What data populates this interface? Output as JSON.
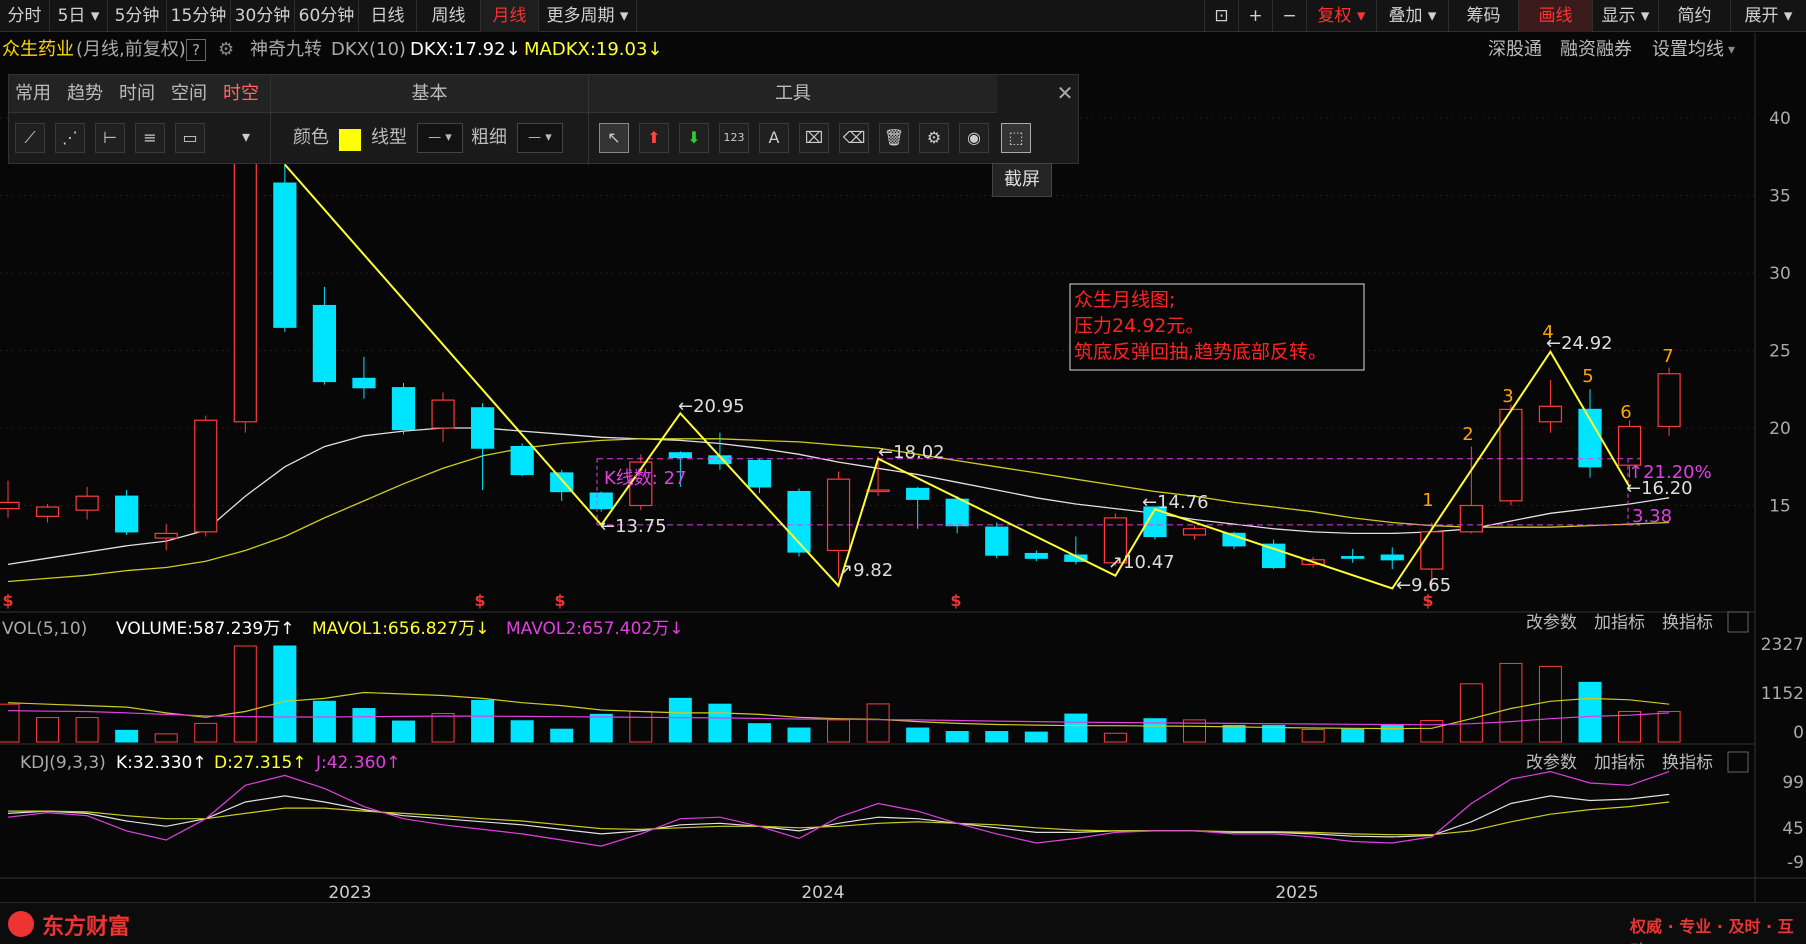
{
  "periods": [
    "分时",
    "5日",
    "5分钟",
    "15分钟",
    "30分钟",
    "60分钟",
    "日线",
    "周线",
    "月线",
    "更多周期"
  ],
  "active_period": "月线",
  "right_buttons": [
    "复权",
    "叠加",
    "筹码",
    "画线",
    "显示",
    "简约",
    "展开"
  ],
  "stock": {
    "name": "众生药业",
    "mode": "(月线,前复权)",
    "help": "?",
    "indicator": "神奇九转",
    "dkx_label": "DKX(10)",
    "dkx": "DKX:17.92↓",
    "madkx": "MADKX:19.03↓"
  },
  "top_links": [
    "深股通",
    "融资融券",
    "设置均线"
  ],
  "draw_panel": {
    "tabs": [
      "常用",
      "趋势",
      "时间",
      "空间",
      "时空"
    ],
    "active_tab": "时空",
    "basic_title": "基本",
    "tools_title": "工具",
    "color_label": "颜色",
    "line_label": "线型",
    "width_label": "粗细",
    "tooltip": "截屏"
  },
  "annotation": [
    "众生月线图;",
    "压力24.92元。",
    "筑底反弹回抽,趋势底部反转。"
  ],
  "price_axis": [
    "40",
    "35",
    "30",
    "25",
    "20",
    "15"
  ],
  "point_labels": {
    "p1": "←20.95",
    "p2": "←18.02",
    "p3": "←14.76",
    "p4": "←13.75",
    "p5": "↗9.82",
    "p6": "↗10.47",
    "p7": "←9.65",
    "p8": "←24.92",
    "p9": "←16.20",
    "k_count": "K线数: 27",
    "pct": "↑21.20%",
    "diff": "3.38"
  },
  "wave_labels": [
    "1",
    "2",
    "3",
    "4",
    "5",
    "6",
    "7"
  ],
  "vol": {
    "label": "VOL(5,10)",
    "volume": "VOLUME:587.239万↑",
    "mavol1": "MAVOL1:656.827万↓",
    "mavol2": "MAVOL2:657.402万↓",
    "axis": [
      "2327",
      "1152",
      "0"
    ]
  },
  "kdj": {
    "label": "KDJ(9,3,3)",
    "k": "K:32.330↑",
    "d": "D:27.315↑",
    "j": "J:42.360↑",
    "axis": [
      "99",
      "45",
      "-9"
    ]
  },
  "panel_links": [
    "改参数",
    "加指标",
    "换指标"
  ],
  "years": [
    "2023",
    "2024",
    "2025"
  ],
  "brand": "东方财富",
  "slogan": "权威 · 专业 · 及时 · 互动",
  "colors": {
    "up": "#ff3b3b",
    "down": "#00e5ff",
    "yellow": "#ffff33",
    "magenta": "#e040e0",
    "white": "#e0e0e0",
    "orange": "#ffa500"
  },
  "chart_data": {
    "type": "candlestick",
    "candles": [
      [
        14.8,
        15.2,
        16.6,
        14.2
      ],
      [
        14.3,
        14.9,
        15.1,
        13.9
      ],
      [
        14.7,
        15.6,
        16.2,
        14.1
      ],
      [
        15.6,
        13.3,
        16.0,
        13.1
      ],
      [
        12.9,
        13.2,
        13.8,
        12.1
      ],
      [
        13.3,
        20.5,
        20.8,
        13.0
      ],
      [
        20.4,
        39.0,
        39.5,
        19.7
      ],
      [
        35.8,
        26.5,
        38.0,
        26.2
      ],
      [
        27.9,
        23.0,
        29.1,
        22.8
      ],
      [
        23.2,
        22.6,
        24.6,
        21.9
      ],
      [
        22.6,
        19.9,
        22.9,
        19.6
      ],
      [
        20.0,
        21.8,
        22.3,
        19.1
      ],
      [
        21.3,
        18.7,
        21.6,
        16.0
      ],
      [
        18.8,
        17.0,
        19.0,
        16.9
      ],
      [
        17.1,
        15.9,
        17.3,
        15.3
      ],
      [
        15.8,
        14.8,
        15.9,
        14.6
      ],
      [
        15.0,
        17.8,
        18.3,
        14.7
      ],
      [
        18.4,
        18.1,
        18.5,
        16.2
      ],
      [
        18.2,
        17.7,
        19.7,
        17.3
      ],
      [
        17.9,
        16.2,
        18.0,
        15.8
      ],
      [
        15.9,
        12.0,
        16.1,
        11.7
      ],
      [
        12.1,
        16.7,
        17.2,
        10.3
      ],
      [
        16.0,
        16.0,
        18.2,
        15.6
      ],
      [
        16.1,
        15.4,
        16.2,
        13.5
      ],
      [
        15.4,
        13.7,
        15.6,
        13.2
      ],
      [
        13.6,
        11.8,
        13.9,
        11.6
      ],
      [
        11.9,
        11.6,
        12.1,
        11.4
      ],
      [
        11.8,
        11.4,
        13.0,
        11.2
      ],
      [
        11.3,
        14.2,
        14.5,
        11.1
      ],
      [
        14.9,
        13.0,
        14.9,
        12.8
      ],
      [
        13.1,
        13.5,
        13.7,
        12.8
      ],
      [
        13.2,
        12.4,
        13.3,
        12.2
      ],
      [
        12.5,
        11.0,
        12.8,
        10.9
      ],
      [
        11.2,
        11.5,
        11.7,
        11.0
      ],
      [
        11.7,
        11.6,
        12.2,
        11.3
      ],
      [
        11.8,
        11.5,
        12.3,
        10.9
      ],
      [
        10.9,
        13.3,
        13.9,
        9.7
      ],
      [
        13.3,
        15.0,
        18.8,
        13.2
      ],
      [
        15.3,
        21.2,
        21.5,
        15.0
      ],
      [
        20.4,
        21.4,
        23.1,
        19.7
      ],
      [
        21.2,
        17.5,
        22.5,
        16.8
      ],
      [
        17.6,
        20.1,
        20.5,
        16.8
      ],
      [
        20.1,
        23.5,
        23.9,
        19.5
      ]
    ],
    "zigzag": [
      [
        7,
        37.0
      ],
      [
        15,
        13.75
      ],
      [
        17,
        20.95
      ],
      [
        21,
        9.82
      ],
      [
        22,
        18.02
      ],
      [
        28,
        10.47
      ],
      [
        29,
        14.76
      ],
      [
        35,
        9.65
      ],
      [
        39,
        24.92
      ],
      [
        41,
        16.2
      ]
    ],
    "ma_white": [
      11.2,
      11.6,
      12.0,
      12.4,
      12.7,
      13.4,
      15.6,
      17.5,
      18.8,
      19.5,
      19.8,
      20.0,
      20.0,
      19.8,
      19.6,
      19.4,
      19.3,
      19.2,
      19.0,
      18.7,
      18.3,
      17.8,
      17.4,
      17.0,
      16.5,
      16.0,
      15.5,
      15.1,
      14.8,
      14.5,
      14.1,
      13.8,
      13.5,
      13.3,
      13.2,
      13.2,
      13.3,
      13.5,
      14.0,
      14.5,
      14.8,
      15.1,
      15.5
    ],
    "ma_yellow": [
      10.1,
      10.3,
      10.5,
      10.8,
      11.0,
      11.4,
      12.1,
      13.0,
      14.2,
      15.3,
      16.4,
      17.4,
      18.2,
      18.7,
      19.0,
      19.2,
      19.3,
      19.3,
      19.3,
      19.2,
      19.1,
      18.9,
      18.7,
      18.3,
      17.9,
      17.5,
      17.1,
      16.7,
      16.3,
      15.9,
      15.6,
      15.2,
      14.9,
      14.6,
      14.2,
      13.9,
      13.7,
      13.6,
      13.6,
      13.6,
      13.7,
      13.8,
      13.9
    ],
    "volume": [
      1300,
      840,
      840,
      400,
      280,
      640,
      3300,
      3300,
      1400,
      1150,
      720,
      980,
      1430,
      730,
      440,
      950,
      1050,
      1500,
      1300,
      630,
      480,
      760,
      1310,
      480,
      360,
      360,
      340,
      960,
      300,
      800,
      760,
      570,
      570,
      430,
      450,
      580,
      740,
      2000,
      2700,
      2600,
      2050,
      1050,
      1050
    ],
    "mavol1": [
      1350,
      1300,
      1250,
      1200,
      1000,
      850,
      1050,
      1400,
      1500,
      1700,
      1650,
      1600,
      1500,
      1350,
      1250,
      1100,
      1050,
      1000,
      1000,
      950,
      850,
      800,
      780,
      700,
      640,
      600,
      580,
      560,
      560,
      550,
      540,
      520,
      500,
      480,
      470,
      460,
      470,
      800,
      1150,
      1400,
      1500,
      1450,
      1300
    ],
    "mavol2": [
      1080,
      1060,
      1050,
      1000,
      950,
      900,
      870,
      860,
      860,
      870,
      880,
      890,
      890,
      880,
      870,
      860,
      850,
      840,
      830,
      810,
      790,
      780,
      770,
      760,
      740,
      720,
      700,
      680,
      670,
      660,
      650,
      640,
      630,
      620,
      610,
      600,
      590,
      630,
      700,
      800,
      880,
      920,
      1000
    ],
    "kdj_k": [
      55,
      58,
      55,
      45,
      38,
      48,
      70,
      78,
      70,
      60,
      52,
      48,
      44,
      40,
      34,
      28,
      32,
      40,
      42,
      38,
      32,
      42,
      50,
      48,
      42,
      36,
      30,
      30,
      32,
      32,
      32,
      30,
      30,
      28,
      25,
      24,
      26,
      44,
      68,
      78,
      72,
      74,
      80
    ],
    "kdj_d": [
      58,
      58,
      57,
      52,
      48,
      48,
      55,
      62,
      62,
      58,
      55,
      52,
      48,
      45,
      40,
      35,
      34,
      36,
      38,
      38,
      36,
      38,
      42,
      44,
      42,
      40,
      36,
      33,
      32,
      32,
      32,
      31,
      31,
      30,
      28,
      27,
      27,
      32,
      44,
      54,
      60,
      64,
      70
    ],
    "kdj_j": [
      50,
      56,
      52,
      32,
      20,
      48,
      92,
      105,
      88,
      64,
      48,
      40,
      34,
      28,
      20,
      12,
      28,
      48,
      50,
      38,
      22,
      50,
      68,
      58,
      42,
      28,
      16,
      22,
      30,
      32,
      32,
      28,
      28,
      24,
      18,
      16,
      24,
      68,
      100,
      110,
      95,
      92,
      110
    ]
  }
}
